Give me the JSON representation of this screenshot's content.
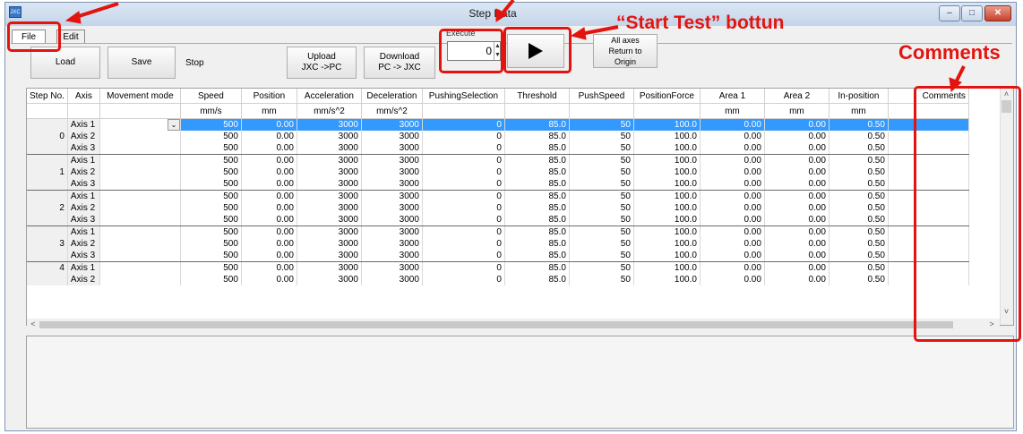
{
  "window": {
    "title": "Step Data",
    "icon": "app-icon",
    "controls": [
      "minimize-icon",
      "maximize-icon",
      "close-icon"
    ]
  },
  "tabs": [
    {
      "label": "File"
    },
    {
      "label": "Edit"
    }
  ],
  "toolbar": {
    "load_label": "Load",
    "save_label": "Save",
    "status": "Stop",
    "upload_label": "Upload\nJXC ->PC",
    "download_label": "Download\nPC -> JXC",
    "execute_label": "Execute",
    "execute_value": "0",
    "play_icon": "play-icon",
    "origin_label": "All axes\nReturn to\nOrigin"
  },
  "table": {
    "columns": [
      "Step No.",
      "Axis",
      "Movement mode",
      "Speed",
      "Position",
      "Acceleration",
      "Deceleration",
      "PushingSelection",
      "Threshold",
      "PushSpeed",
      "PositionForce",
      "Area 1",
      "Area 2",
      "In-position",
      "Comments"
    ],
    "units": [
      "",
      "",
      "",
      "mm/s",
      "mm",
      "mm/s^2",
      "mm/s^2",
      "",
      "",
      "",
      "",
      "mm",
      "mm",
      "mm",
      ""
    ],
    "rows": [
      {
        "step": "",
        "axis": "Axis 1",
        "mode": "",
        "speed": "500",
        "position": "0.00",
        "accel": "3000",
        "decel": "3000",
        "push": "0",
        "threshold": "85.0",
        "pushspeed": "50",
        "force": "100.0",
        "area1": "0.00",
        "area2": "0.00",
        "inpos": "0.50"
      },
      {
        "step": "0",
        "axis": "Axis 2",
        "mode": "",
        "speed": "500",
        "position": "0.00",
        "accel": "3000",
        "decel": "3000",
        "push": "0",
        "threshold": "85.0",
        "pushspeed": "50",
        "force": "100.0",
        "area1": "0.00",
        "area2": "0.00",
        "inpos": "0.50"
      },
      {
        "step": "",
        "axis": "Axis 3",
        "mode": "",
        "speed": "500",
        "position": "0.00",
        "accel": "3000",
        "decel": "3000",
        "push": "0",
        "threshold": "85.0",
        "pushspeed": "50",
        "force": "100.0",
        "area1": "0.00",
        "area2": "0.00",
        "inpos": "0.50"
      },
      {
        "step": "",
        "axis": "Axis 1",
        "mode": "",
        "speed": "500",
        "position": "0.00",
        "accel": "3000",
        "decel": "3000",
        "push": "0",
        "threshold": "85.0",
        "pushspeed": "50",
        "force": "100.0",
        "area1": "0.00",
        "area2": "0.00",
        "inpos": "0.50"
      },
      {
        "step": "1",
        "axis": "Axis 2",
        "mode": "",
        "speed": "500",
        "position": "0.00",
        "accel": "3000",
        "decel": "3000",
        "push": "0",
        "threshold": "85.0",
        "pushspeed": "50",
        "force": "100.0",
        "area1": "0.00",
        "area2": "0.00",
        "inpos": "0.50"
      },
      {
        "step": "",
        "axis": "Axis 3",
        "mode": "",
        "speed": "500",
        "position": "0.00",
        "accel": "3000",
        "decel": "3000",
        "push": "0",
        "threshold": "85.0",
        "pushspeed": "50",
        "force": "100.0",
        "area1": "0.00",
        "area2": "0.00",
        "inpos": "0.50"
      },
      {
        "step": "",
        "axis": "Axis 1",
        "mode": "",
        "speed": "500",
        "position": "0.00",
        "accel": "3000",
        "decel": "3000",
        "push": "0",
        "threshold": "85.0",
        "pushspeed": "50",
        "force": "100.0",
        "area1": "0.00",
        "area2": "0.00",
        "inpos": "0.50"
      },
      {
        "step": "2",
        "axis": "Axis 2",
        "mode": "",
        "speed": "500",
        "position": "0.00",
        "accel": "3000",
        "decel": "3000",
        "push": "0",
        "threshold": "85.0",
        "pushspeed": "50",
        "force": "100.0",
        "area1": "0.00",
        "area2": "0.00",
        "inpos": "0.50"
      },
      {
        "step": "",
        "axis": "Axis 3",
        "mode": "",
        "speed": "500",
        "position": "0.00",
        "accel": "3000",
        "decel": "3000",
        "push": "0",
        "threshold": "85.0",
        "pushspeed": "50",
        "force": "100.0",
        "area1": "0.00",
        "area2": "0.00",
        "inpos": "0.50"
      },
      {
        "step": "",
        "axis": "Axis 1",
        "mode": "",
        "speed": "500",
        "position": "0.00",
        "accel": "3000",
        "decel": "3000",
        "push": "0",
        "threshold": "85.0",
        "pushspeed": "50",
        "force": "100.0",
        "area1": "0.00",
        "area2": "0.00",
        "inpos": "0.50"
      },
      {
        "step": "3",
        "axis": "Axis 2",
        "mode": "",
        "speed": "500",
        "position": "0.00",
        "accel": "3000",
        "decel": "3000",
        "push": "0",
        "threshold": "85.0",
        "pushspeed": "50",
        "force": "100.0",
        "area1": "0.00",
        "area2": "0.00",
        "inpos": "0.50"
      },
      {
        "step": "",
        "axis": "Axis 3",
        "mode": "",
        "speed": "500",
        "position": "0.00",
        "accel": "3000",
        "decel": "3000",
        "push": "0",
        "threshold": "85.0",
        "pushspeed": "50",
        "force": "100.0",
        "area1": "0.00",
        "area2": "0.00",
        "inpos": "0.50"
      },
      {
        "step": "4",
        "axis": "Axis 1",
        "mode": "",
        "speed": "500",
        "position": "0.00",
        "accel": "3000",
        "decel": "3000",
        "push": "0",
        "threshold": "85.0",
        "pushspeed": "50",
        "force": "100.0",
        "area1": "0.00",
        "area2": "0.00",
        "inpos": "0.50"
      },
      {
        "step": "",
        "axis": "Axis 2",
        "mode": "",
        "speed": "500",
        "position": "0.00",
        "accel": "3000",
        "decel": "3000",
        "push": "0",
        "threshold": "85.0",
        "pushspeed": "50",
        "force": "100.0",
        "area1": "0.00",
        "area2": "0.00",
        "inpos": "0.50"
      }
    ]
  },
  "annotations": {
    "start_test": "“Start Test” bottun",
    "comments": "Comments",
    "color": "#e3140f"
  },
  "colors": {
    "selection": "#3399ff",
    "annotation": "#e3140f"
  }
}
